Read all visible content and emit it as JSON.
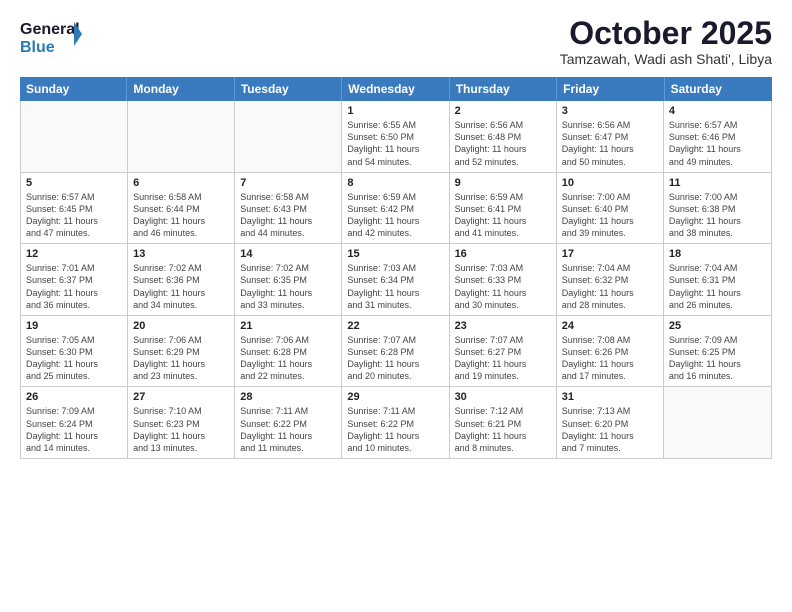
{
  "header": {
    "logo_line1": "General",
    "logo_line2": "Blue",
    "month": "October 2025",
    "location": "Tamzawah, Wadi ash Shati', Libya"
  },
  "weekdays": [
    "Sunday",
    "Monday",
    "Tuesday",
    "Wednesday",
    "Thursday",
    "Friday",
    "Saturday"
  ],
  "rows": [
    [
      {
        "day": "",
        "info": ""
      },
      {
        "day": "",
        "info": ""
      },
      {
        "day": "",
        "info": ""
      },
      {
        "day": "1",
        "info": "Sunrise: 6:55 AM\nSunset: 6:50 PM\nDaylight: 11 hours\nand 54 minutes."
      },
      {
        "day": "2",
        "info": "Sunrise: 6:56 AM\nSunset: 6:48 PM\nDaylight: 11 hours\nand 52 minutes."
      },
      {
        "day": "3",
        "info": "Sunrise: 6:56 AM\nSunset: 6:47 PM\nDaylight: 11 hours\nand 50 minutes."
      },
      {
        "day": "4",
        "info": "Sunrise: 6:57 AM\nSunset: 6:46 PM\nDaylight: 11 hours\nand 49 minutes."
      }
    ],
    [
      {
        "day": "5",
        "info": "Sunrise: 6:57 AM\nSunset: 6:45 PM\nDaylight: 11 hours\nand 47 minutes."
      },
      {
        "day": "6",
        "info": "Sunrise: 6:58 AM\nSunset: 6:44 PM\nDaylight: 11 hours\nand 46 minutes."
      },
      {
        "day": "7",
        "info": "Sunrise: 6:58 AM\nSunset: 6:43 PM\nDaylight: 11 hours\nand 44 minutes."
      },
      {
        "day": "8",
        "info": "Sunrise: 6:59 AM\nSunset: 6:42 PM\nDaylight: 11 hours\nand 42 minutes."
      },
      {
        "day": "9",
        "info": "Sunrise: 6:59 AM\nSunset: 6:41 PM\nDaylight: 11 hours\nand 41 minutes."
      },
      {
        "day": "10",
        "info": "Sunrise: 7:00 AM\nSunset: 6:40 PM\nDaylight: 11 hours\nand 39 minutes."
      },
      {
        "day": "11",
        "info": "Sunrise: 7:00 AM\nSunset: 6:38 PM\nDaylight: 11 hours\nand 38 minutes."
      }
    ],
    [
      {
        "day": "12",
        "info": "Sunrise: 7:01 AM\nSunset: 6:37 PM\nDaylight: 11 hours\nand 36 minutes."
      },
      {
        "day": "13",
        "info": "Sunrise: 7:02 AM\nSunset: 6:36 PM\nDaylight: 11 hours\nand 34 minutes."
      },
      {
        "day": "14",
        "info": "Sunrise: 7:02 AM\nSunset: 6:35 PM\nDaylight: 11 hours\nand 33 minutes."
      },
      {
        "day": "15",
        "info": "Sunrise: 7:03 AM\nSunset: 6:34 PM\nDaylight: 11 hours\nand 31 minutes."
      },
      {
        "day": "16",
        "info": "Sunrise: 7:03 AM\nSunset: 6:33 PM\nDaylight: 11 hours\nand 30 minutes."
      },
      {
        "day": "17",
        "info": "Sunrise: 7:04 AM\nSunset: 6:32 PM\nDaylight: 11 hours\nand 28 minutes."
      },
      {
        "day": "18",
        "info": "Sunrise: 7:04 AM\nSunset: 6:31 PM\nDaylight: 11 hours\nand 26 minutes."
      }
    ],
    [
      {
        "day": "19",
        "info": "Sunrise: 7:05 AM\nSunset: 6:30 PM\nDaylight: 11 hours\nand 25 minutes."
      },
      {
        "day": "20",
        "info": "Sunrise: 7:06 AM\nSunset: 6:29 PM\nDaylight: 11 hours\nand 23 minutes."
      },
      {
        "day": "21",
        "info": "Sunrise: 7:06 AM\nSunset: 6:28 PM\nDaylight: 11 hours\nand 22 minutes."
      },
      {
        "day": "22",
        "info": "Sunrise: 7:07 AM\nSunset: 6:28 PM\nDaylight: 11 hours\nand 20 minutes."
      },
      {
        "day": "23",
        "info": "Sunrise: 7:07 AM\nSunset: 6:27 PM\nDaylight: 11 hours\nand 19 minutes."
      },
      {
        "day": "24",
        "info": "Sunrise: 7:08 AM\nSunset: 6:26 PM\nDaylight: 11 hours\nand 17 minutes."
      },
      {
        "day": "25",
        "info": "Sunrise: 7:09 AM\nSunset: 6:25 PM\nDaylight: 11 hours\nand 16 minutes."
      }
    ],
    [
      {
        "day": "26",
        "info": "Sunrise: 7:09 AM\nSunset: 6:24 PM\nDaylight: 11 hours\nand 14 minutes."
      },
      {
        "day": "27",
        "info": "Sunrise: 7:10 AM\nSunset: 6:23 PM\nDaylight: 11 hours\nand 13 minutes."
      },
      {
        "day": "28",
        "info": "Sunrise: 7:11 AM\nSunset: 6:22 PM\nDaylight: 11 hours\nand 11 minutes."
      },
      {
        "day": "29",
        "info": "Sunrise: 7:11 AM\nSunset: 6:22 PM\nDaylight: 11 hours\nand 10 minutes."
      },
      {
        "day": "30",
        "info": "Sunrise: 7:12 AM\nSunset: 6:21 PM\nDaylight: 11 hours\nand 8 minutes."
      },
      {
        "day": "31",
        "info": "Sunrise: 7:13 AM\nSunset: 6:20 PM\nDaylight: 11 hours\nand 7 minutes."
      },
      {
        "day": "",
        "info": ""
      }
    ]
  ]
}
